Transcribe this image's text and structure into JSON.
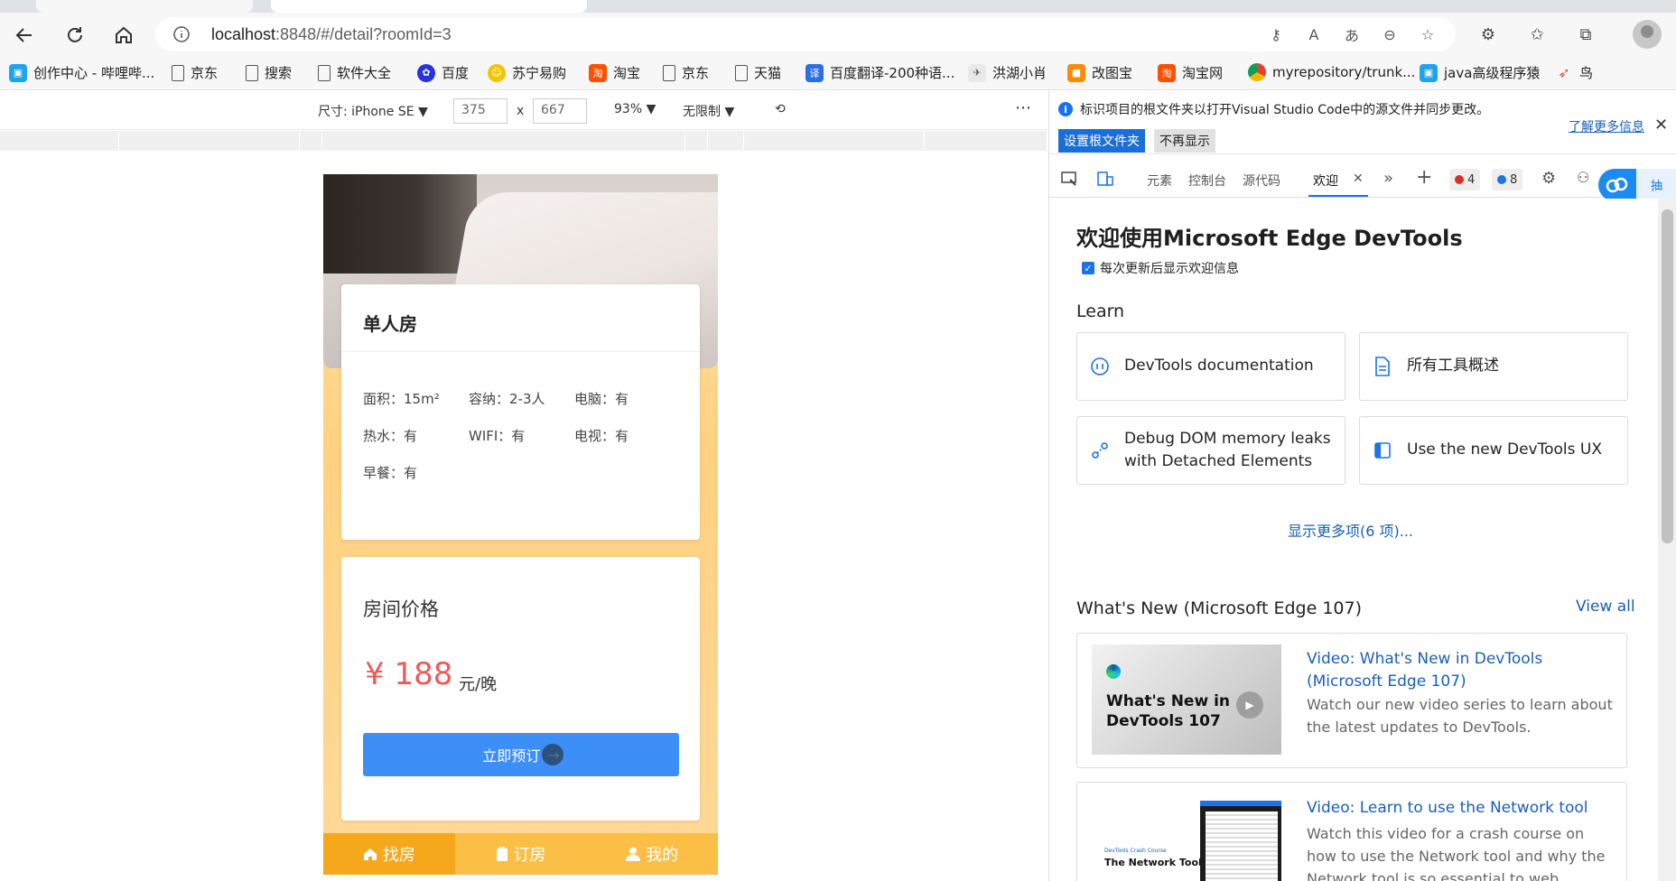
{
  "browser": {
    "url_host": "localhost",
    "url_rest": ":8848/#/detail?roomId=3"
  },
  "favorites": [
    {
      "label": "创作中心 - 哔哩哔...",
      "icon": "bilibili-icon",
      "color": "#1fa2f0"
    },
    {
      "label": "京东",
      "icon": "page-icon",
      "color": "#555555"
    },
    {
      "label": "搜索",
      "icon": "page-icon",
      "color": "#555555"
    },
    {
      "label": "软件大全",
      "icon": "page-icon",
      "color": "#555555"
    },
    {
      "label": "百度",
      "icon": "baidu-paw-icon",
      "color": "#2932e1"
    },
    {
      "label": "苏宁易购",
      "icon": "suning-icon",
      "color": "#f5c400"
    },
    {
      "label": "淘宝",
      "icon": "taobao-icon",
      "color": "#ff5000"
    },
    {
      "label": "京东",
      "icon": "page-icon",
      "color": "#555555"
    },
    {
      "label": "天猫",
      "icon": "page-icon",
      "color": "#555555"
    },
    {
      "label": "百度翻译-200种语...",
      "icon": "baidu-translate-icon",
      "color": "#2d6fe3"
    },
    {
      "label": "洪湖小肖",
      "icon": "bird-icon",
      "color": "#888888"
    },
    {
      "label": "改图宝",
      "icon": "gaitubao-icon",
      "color": "#ff8a00"
    },
    {
      "label": "淘宝网",
      "icon": "taobao-icon",
      "color": "#ff5000"
    },
    {
      "label": "myrepository/trunk...",
      "icon": "chrome-icon",
      "color": "#db4437"
    },
    {
      "label": "java高级程序猿",
      "icon": "bilibili-icon",
      "color": "#1fa2f0"
    },
    {
      "label": "鸟",
      "icon": "swallow-icon",
      "color": "#e94b35"
    }
  ],
  "device_toolbar": {
    "size_label": "尺寸: iPhone SE",
    "width": "375",
    "times": "x",
    "height": "667",
    "zoom": "93%",
    "throttle": "无限制"
  },
  "room": {
    "name": "单人房",
    "specs": [
      {
        "label": "面积：15m²"
      },
      {
        "label": "容纳：2-3人"
      },
      {
        "label": "电脑：有"
      },
      {
        "label": "热水：有"
      },
      {
        "label": "WIFI：有"
      },
      {
        "label": "电视：有"
      },
      {
        "label": "早餐：有"
      }
    ],
    "price_title": "房间价格",
    "price": "¥ 188",
    "price_unit": "元/晚",
    "book_label": "立即预订",
    "book_arrow": "→"
  },
  "tabbar": [
    {
      "label": "找房",
      "icon": "home-icon",
      "active": true
    },
    {
      "label": "订房",
      "icon": "clipboard-icon",
      "active": false
    },
    {
      "label": "我的",
      "icon": "user-icon",
      "active": false
    }
  ],
  "colors": {
    "accent_blue": "#3d8ff8",
    "price_red": "#ee5a5a",
    "tab_active": "#f6a81d",
    "tab_inactive": "#fbbf45",
    "devtools_link": "#1a5fb4"
  },
  "devtools": {
    "infobar_message": "标识项目的根文件夹以打开Visual Studio Code中的源文件并同步更改。",
    "set_root_btn": "设置根文件夹",
    "dont_show_btn": "不再显示",
    "learn_more": "了解更多信息",
    "tabs": [
      "元素",
      "控制台",
      "源代码",
      "欢迎"
    ],
    "error_count": "4",
    "message_count": "8",
    "side_label": "抽",
    "welcome_title": "欢迎使用Microsoft Edge DevTools",
    "show_welcome_checkbox": "每次更新后显示欢迎信息",
    "learn_heading": "Learn",
    "learn_cards": [
      {
        "label": "DevTools documentation",
        "icon": "devtools-doc-icon"
      },
      {
        "label": "所有工具概述",
        "icon": "document-icon"
      },
      {
        "label": "Debug DOM memory leaks with Detached Elements",
        "icon": "detach-icon"
      },
      {
        "label": "Use the new DevTools UX",
        "icon": "panel-icon"
      }
    ],
    "more_link": "显示更多项(6 项)...",
    "whats_new_heading": "What's New (Microsoft Edge 107)",
    "view_all": "View all",
    "news": [
      {
        "title": "Video: What's New in DevTools (Microsoft Edge 107)",
        "desc": "Watch our new video series to learn about the latest updates to DevTools.",
        "thumb_text": "What's New in DevTools 107"
      },
      {
        "title": "Video: Learn to use the Network tool",
        "desc": "Watch this video for a crash course on how to use the Network tool and why the Network tool is so essential to web",
        "thumb_small": "DevTools Crash Course",
        "thumb_text": "The Network Tool"
      }
    ]
  }
}
